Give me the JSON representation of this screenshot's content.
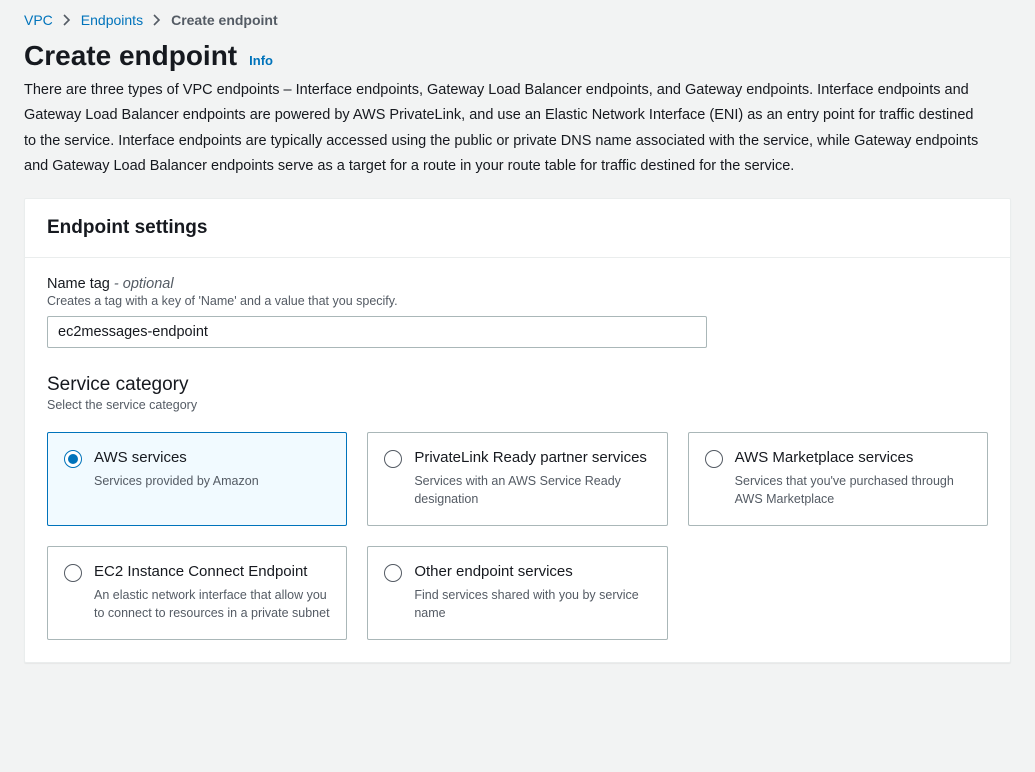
{
  "breadcrumb": {
    "items": [
      {
        "label": "VPC"
      },
      {
        "label": "Endpoints"
      }
    ],
    "current": "Create endpoint"
  },
  "page": {
    "title": "Create endpoint",
    "info_label": "Info",
    "description": "There are three types of VPC endpoints – Interface endpoints, Gateway Load Balancer endpoints, and Gateway endpoints. Interface endpoints and Gateway Load Balancer endpoints are powered by AWS PrivateLink, and use an Elastic Network Interface (ENI) as an entry point for traffic destined to the service. Interface endpoints are typically accessed using the public or private DNS name associated with the service, while Gateway endpoints and Gateway Load Balancer endpoints serve as a target for a route in your route table for traffic destined for the service."
  },
  "panel": {
    "title": "Endpoint settings",
    "name_field": {
      "label": "Name tag",
      "optional_suffix": " - optional",
      "hint": "Creates a tag with a key of 'Name' and a value that you specify.",
      "value": "ec2messages-endpoint"
    },
    "category": {
      "title": "Service category",
      "hint": "Select the service category",
      "options": [
        {
          "title": "AWS services",
          "desc": "Services provided by Amazon",
          "selected": true
        },
        {
          "title": "PrivateLink Ready partner services",
          "desc": "Services with an AWS Service Ready designation",
          "selected": false
        },
        {
          "title": "AWS Marketplace services",
          "desc": "Services that you've purchased through AWS Marketplace",
          "selected": false
        },
        {
          "title": "EC2 Instance Connect Endpoint",
          "desc": "An elastic network interface that allow you to connect to resources in a private subnet",
          "selected": false
        },
        {
          "title": "Other endpoint services",
          "desc": "Find services shared with you by service name",
          "selected": false
        }
      ]
    }
  }
}
